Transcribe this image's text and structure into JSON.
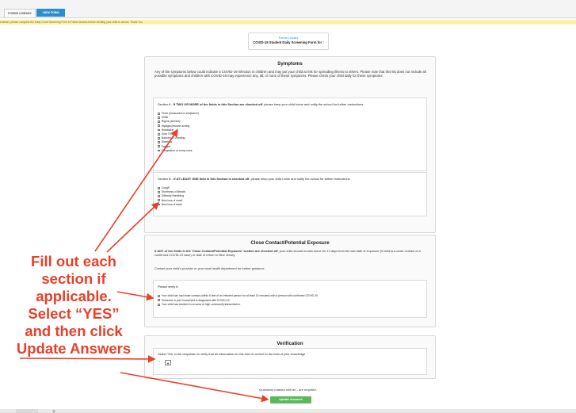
{
  "tabs": [
    {
      "label": "FORMS LIBRARY"
    },
    {
      "label": "VIEW FORM"
    }
  ],
  "banner": "eminder, please complete the Daily Covid Screening Form in Parent Access before sending your child to school. Thank You.",
  "header": {
    "library": "Forms Library",
    "title": "COVID-19 Student Daily Screening Form for :"
  },
  "symptoms": {
    "title": "Symptoms",
    "intro": "Any of the symptoms below could indicate a COVID-19 infection in children and may put your child at risk for spreading illness to others. Please note that this list does not include all possible symptoms and children with COVID-19 may experience any, all, or none of these symptoms. Please check your child daily for these symptoms",
    "section_a": {
      "prefix": "Section A - ",
      "bold": "If TWO OR MORE of the fields in this Section are checked off",
      "suffix": ", please keep your child home and notify the school for further instructions.",
      "items": [
        "Fever (measured or subjective)",
        "Chills",
        "Rigors (shivers)",
        "Myalgia (muscle aches)",
        "Headache",
        "Sore Throat",
        "Nausea or Vomiting",
        "Diarrhea",
        "Fatigue",
        "Congestion or runny nose"
      ]
    },
    "section_b": {
      "prefix": "Section B - ",
      "bold": "If AT LEAST ONE field in this Section is checked off",
      "suffix": ", please keep your child home and notify the school for further instructions",
      "items": [
        "Cough",
        "Shortness of Breath",
        "Difficulty Breathing",
        "New loss of smell",
        "New loss of taste"
      ]
    }
  },
  "contact": {
    "title": "Close Contact/Potential Exposure",
    "para_bold": "If ANY of the fields in the 'Close Contact/Potential Exposure' section are checked off",
    "para_rest": ", your child should remain home for 14 days from the last date of exposure (If child is a close contact of a confirmed COVID-19 case) or date of return to New Jersey.",
    "para2": "Contact your child's provider or your local health department for further guidance.",
    "verify_label": "Please verify if:",
    "items": [
      "Your child has had close contact (within 6 feet of an infected person for at least 10 minutes) with a person with confirmed COVID-19",
      "Someone in your household is diagnosed with COVID-19",
      "Your child has traveled to an area of high community transmission."
    ]
  },
  "verification": {
    "title": "Verification",
    "label": "Select 'Yes' in the dropdown to verify that all information on this form is correct to the best of your knowledge",
    "select_value": "-"
  },
  "required_note": "Questions marked with an - are required.",
  "update_button": "Update Answers",
  "annotation": {
    "lines": [
      "Fill out each",
      "section if",
      "applicable.",
      "Select “YES”",
      "and then click",
      "Update Answers"
    ]
  },
  "colors": {
    "accent": "#2b8fcf",
    "annotation": "#e8402a",
    "button": "#5cb85c",
    "banner": "#fcf1a8"
  }
}
